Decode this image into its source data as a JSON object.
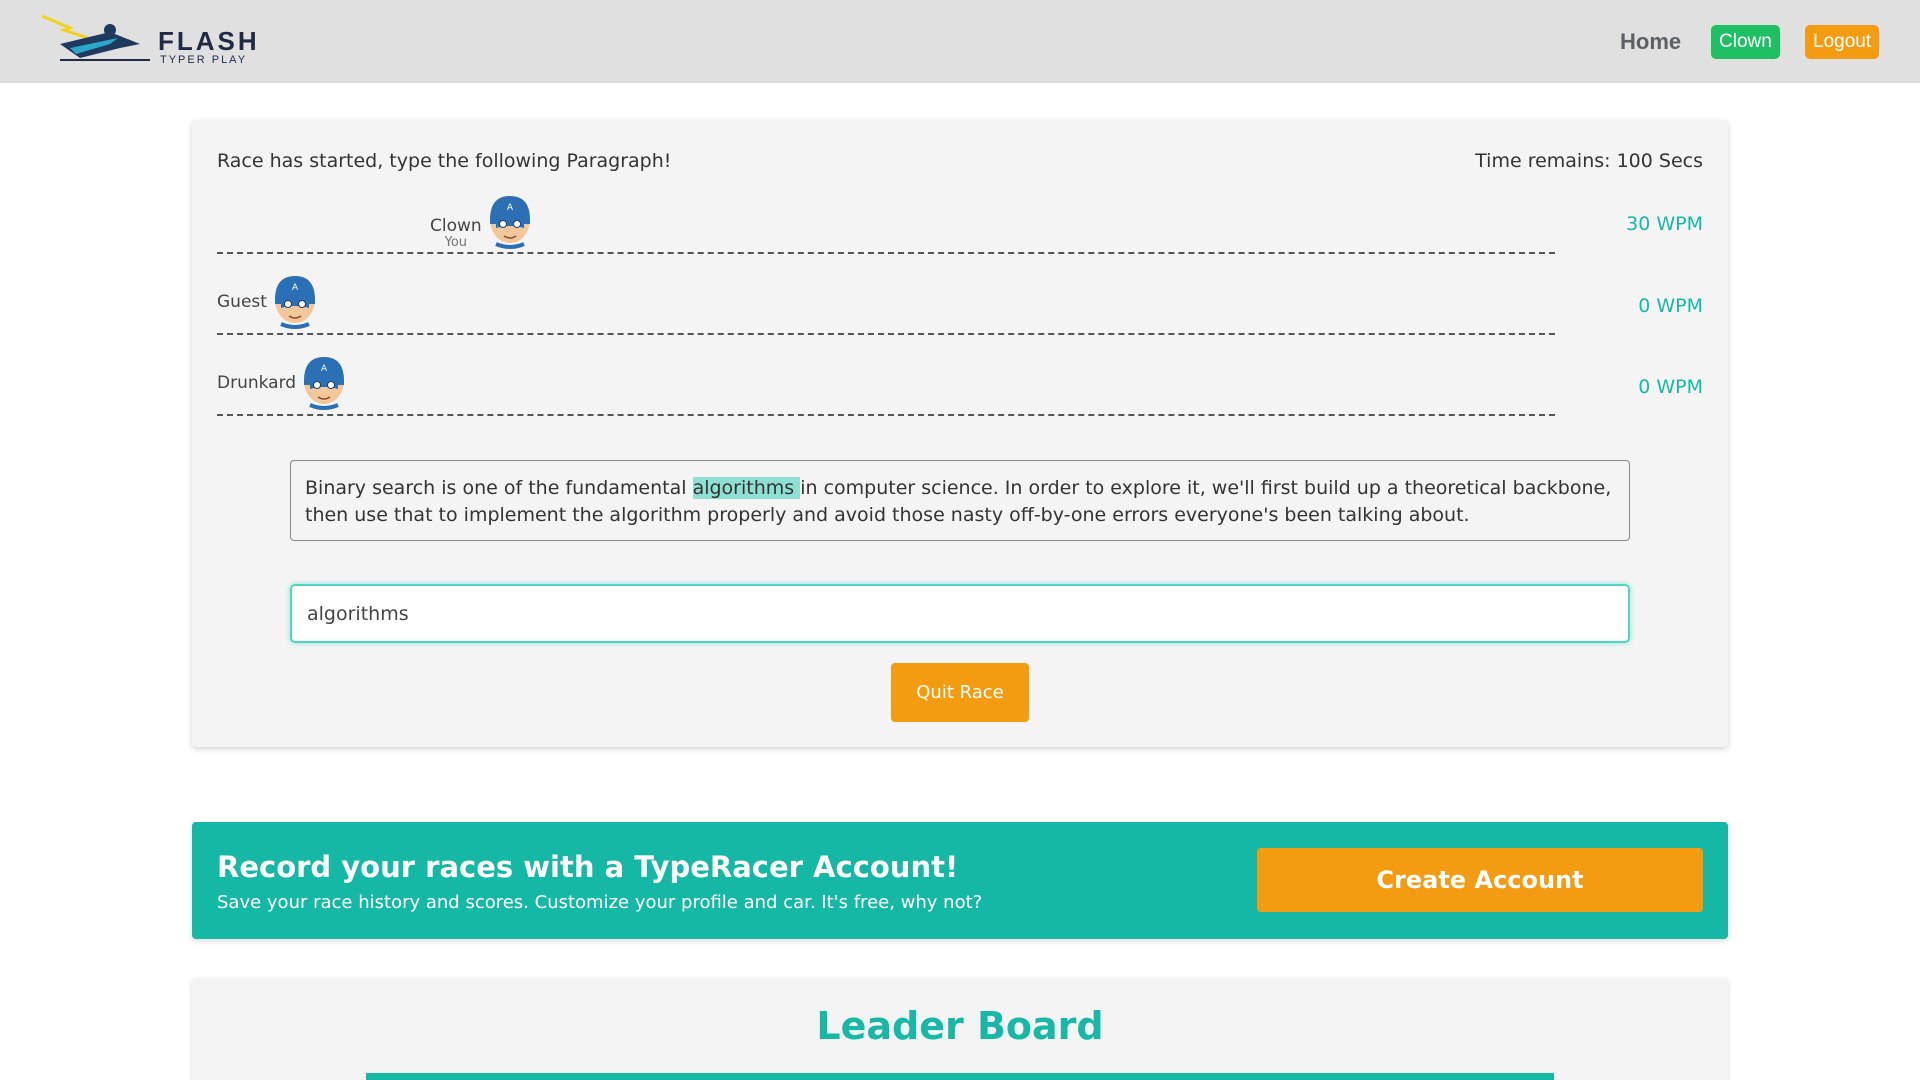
{
  "brand": {
    "name": "FLASH",
    "tagline": "TYPER PLAY"
  },
  "nav": {
    "home": "Home",
    "user": "Clown",
    "logout": "Logout"
  },
  "race": {
    "status": "Race has started, type the following Paragraph!",
    "timer": "Time remains: 100 Secs",
    "racers": [
      {
        "name": "Clown",
        "tag": "You",
        "wpm": "30 WPM",
        "progress": 0.2
      },
      {
        "name": "Guest",
        "tag": "",
        "wpm": "0 WPM",
        "progress": 0
      },
      {
        "name": "Drunkard",
        "tag": "",
        "wpm": "0 WPM",
        "progress": 0
      }
    ],
    "paragraph": {
      "before": "Binary search is one of the fundamental ",
      "current": "algorithms ",
      "after": "in computer science. In order to explore it, we'll first build up a theoretical backbone, then use that to implement the algorithm properly and avoid those nasty off-by-one errors everyone's been talking about."
    },
    "input_value": "algorithms",
    "quit_label": "Quit Race"
  },
  "banner": {
    "title": "Record your races with a TypeRacer Account!",
    "subtitle": "Save your race history and scores. Customize your profile and car. It's free, why not?",
    "button": "Create Account"
  },
  "leaderboard": {
    "title": "Leader Board"
  },
  "colors": {
    "accent": "#15b8a5",
    "orange": "#f39c12",
    "green": "#1fbf63"
  },
  "icons": {
    "logo": "flash-runner-logo",
    "avatar": "masked-hero-avatar-icon"
  }
}
